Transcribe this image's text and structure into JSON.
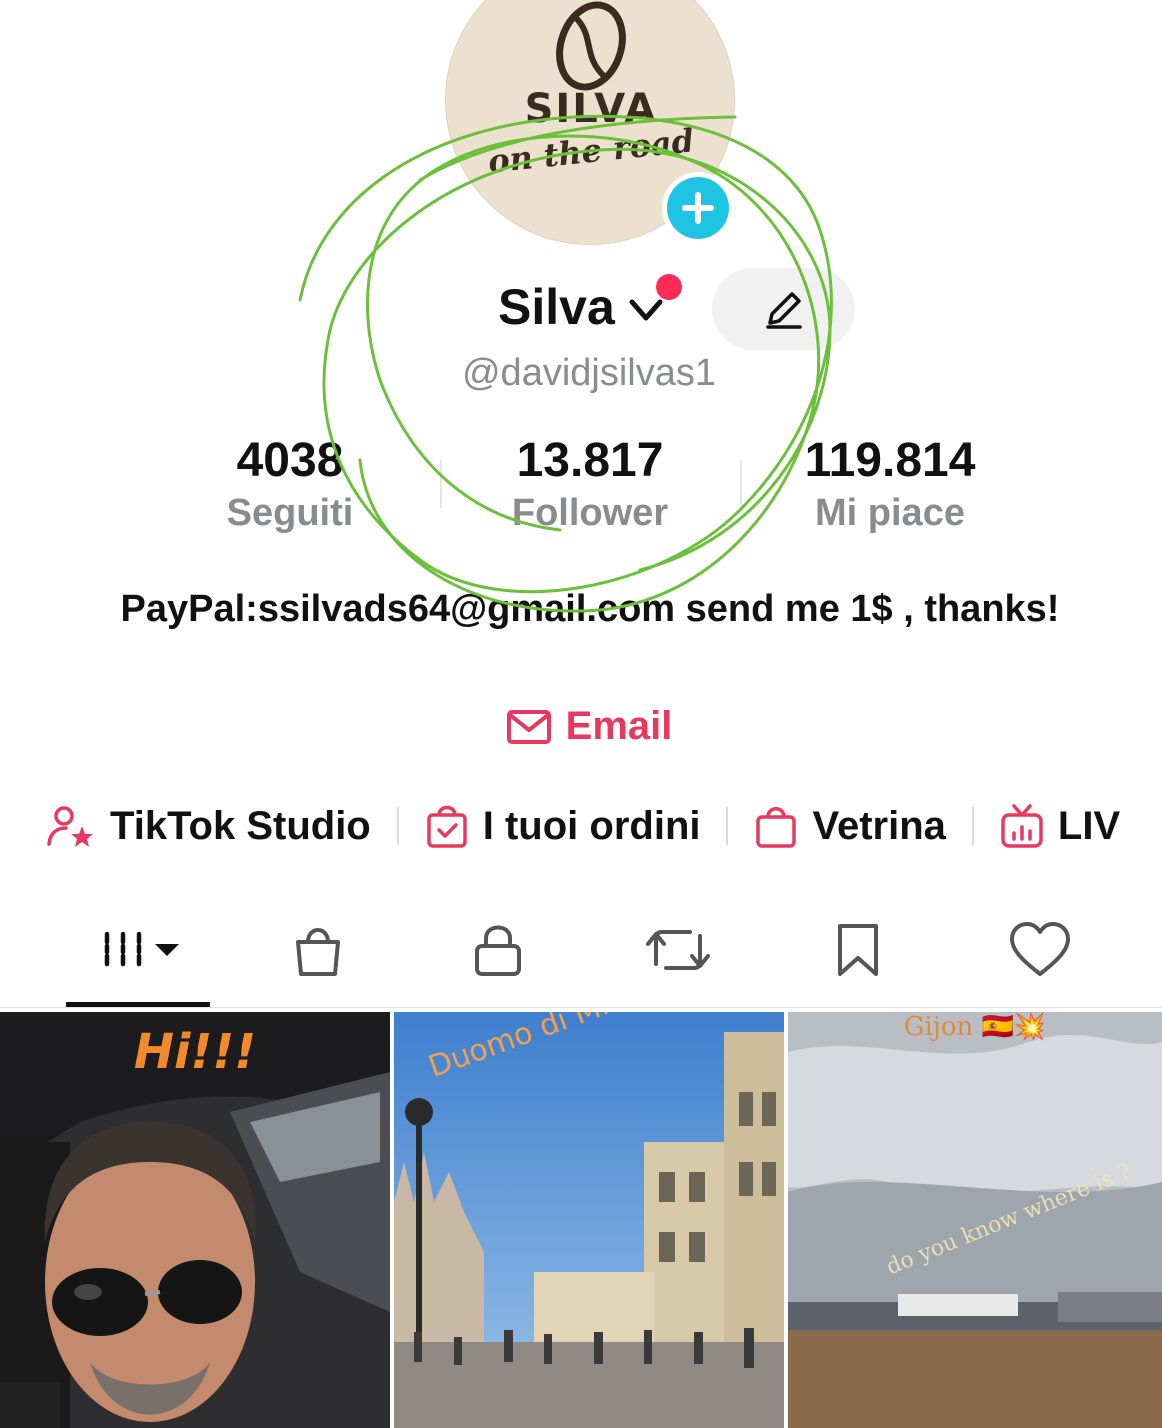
{
  "avatar": {
    "brand_line1": "SILVA",
    "brand_line2": "on the road"
  },
  "profile": {
    "display_name": "Silva",
    "username": "@davidjsilvas1",
    "bio": "PayPal:ssilvads64@gmail.com send me 1$ , thanks!",
    "email_label": "Email"
  },
  "stats": [
    {
      "value": "4038",
      "label": "Seguiti"
    },
    {
      "value": "13.817",
      "label": "Follower"
    },
    {
      "value": "119.814",
      "label": "Mi piace"
    }
  ],
  "shortcuts": [
    {
      "label": "TikTok Studio",
      "icon": "person-star-icon"
    },
    {
      "label": "I tuoi ordini",
      "icon": "bag-check-icon"
    },
    {
      "label": "Vetrina",
      "icon": "shopping-bag-icon"
    },
    {
      "label": "LIV",
      "icon": "live-tv-icon"
    }
  ],
  "tabs": [
    {
      "name": "videos",
      "icon": "grid-icon",
      "active": true
    },
    {
      "name": "shop",
      "icon": "bag-icon"
    },
    {
      "name": "private",
      "icon": "lock-icon"
    },
    {
      "name": "reposts",
      "icon": "repost-icon"
    },
    {
      "name": "saved",
      "icon": "bookmark-icon"
    },
    {
      "name": "liked",
      "icon": "heart-icon"
    }
  ],
  "videos": [
    {
      "caption": "Hi!!!"
    },
    {
      "caption": "Duomo di Milano"
    },
    {
      "caption": "Gijon 🇪🇸💥",
      "overlay_text": "do you know where is ?"
    }
  ],
  "colors": {
    "accent_red": "#fe2c55",
    "email_red": "#e8385f",
    "add_button": "#20c4e3",
    "annotation_green": "#6cbf3a"
  }
}
